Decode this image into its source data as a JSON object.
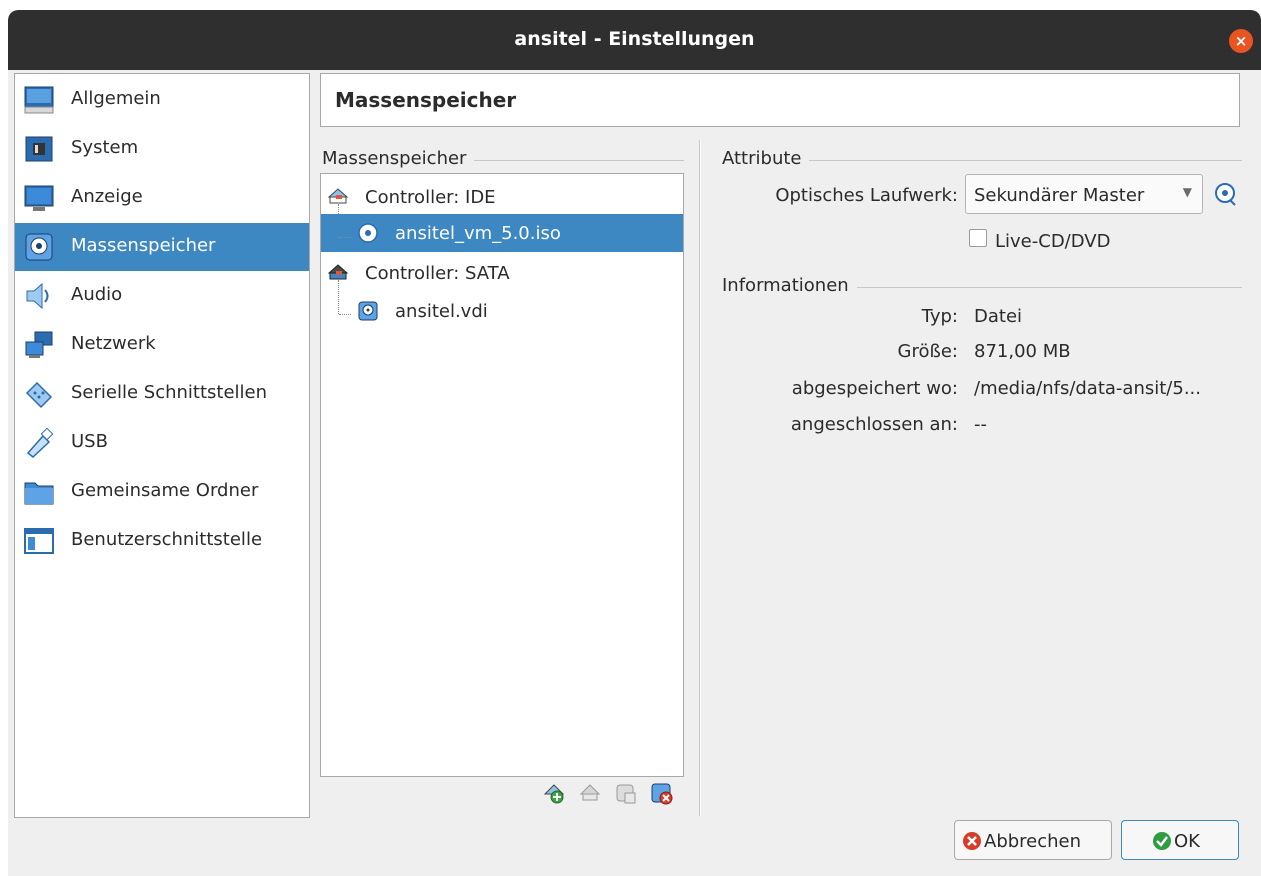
{
  "window": {
    "title": "ansitel - Einstellungen",
    "close_symbol": "×"
  },
  "sidebar": {
    "items": [
      {
        "label": "Allgemein",
        "icon": "general-monitor-icon"
      },
      {
        "label": "System",
        "icon": "chip-icon"
      },
      {
        "label": "Anzeige",
        "icon": "display-icon"
      },
      {
        "label": "Massenspeicher",
        "icon": "storage-disk-icon",
        "selected": true
      },
      {
        "label": "Audio",
        "icon": "speaker-icon"
      },
      {
        "label": "Netzwerk",
        "icon": "network-icon"
      },
      {
        "label": "Serielle Schnittstellen",
        "icon": "serial-port-icon"
      },
      {
        "label": "USB",
        "icon": "usb-icon"
      },
      {
        "label": "Gemeinsame Ordner",
        "icon": "folder-icon"
      },
      {
        "label": "Benutzerschnittstelle",
        "icon": "user-interface-icon"
      }
    ]
  },
  "page": {
    "title": "Massenspeicher"
  },
  "storage": {
    "group_title": "Massenspeicher",
    "tree": [
      {
        "label": "Controller: IDE",
        "type": "controller"
      },
      {
        "label": "ansitel_vm_5.0.iso",
        "type": "optical",
        "selected": true
      },
      {
        "label": "Controller: SATA",
        "type": "controller"
      },
      {
        "label": "ansitel.vdi",
        "type": "harddisk"
      }
    ],
    "toolbar": [
      "add-attachment-icon",
      "remove-attachment-icon",
      "add-controller-icon",
      "remove-controller-icon"
    ]
  },
  "attributes": {
    "group_title": "Attribute",
    "optical_drive_label": "Optisches Laufwerk:",
    "optical_drive_value": "Sekundärer Master",
    "live_cd_label": "Live-CD/DVD",
    "live_cd_checked": false
  },
  "information": {
    "group_title": "Informationen",
    "rows": [
      {
        "label": "Typ:",
        "value": "Datei"
      },
      {
        "label": "Größe:",
        "value": "871,00 MB"
      },
      {
        "label": "abgespeichert wo:",
        "value": "/media/nfs/data-ansit/5..."
      },
      {
        "label": "angeschlossen an:",
        "value": "--"
      }
    ]
  },
  "buttons": {
    "cancel": "Abbrechen",
    "ok": "OK"
  },
  "colors": {
    "accent": "#3d87c3",
    "titlebar": "#2f2f2f",
    "close": "#e95420",
    "background": "#efefef"
  }
}
